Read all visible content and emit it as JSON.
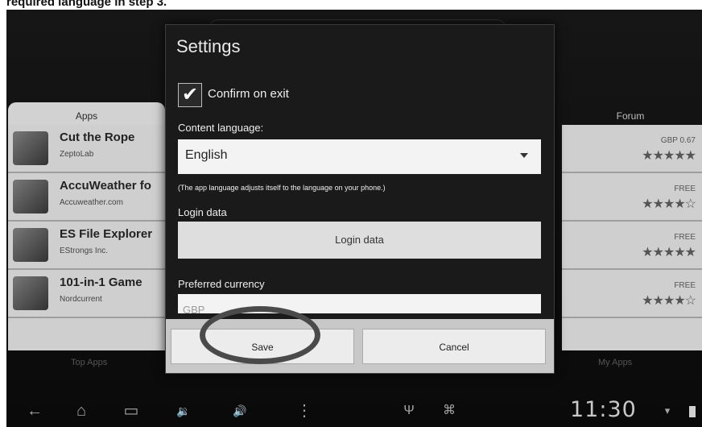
{
  "caption": "required language in step 3.",
  "background": {
    "tabs": {
      "apps": "Apps",
      "forum": "Forum"
    },
    "apps": [
      {
        "title": "Cut the Rope",
        "developer": "ZeptoLab",
        "price": "GBP 0.67",
        "stars": "★★★★★"
      },
      {
        "title": "AccuWeather fo",
        "developer": "Accuweather.com",
        "price": "FREE",
        "stars": "★★★★☆"
      },
      {
        "title": "ES File Explorer",
        "developer": "EStrongs Inc.",
        "price": "FREE",
        "stars": "★★★★★"
      },
      {
        "title": "101-in-1 Game",
        "developer": "Nordcurrent",
        "price": "FREE",
        "stars": "★★★★☆"
      }
    ],
    "bottom_tabs": {
      "left": "Top Apps",
      "right": "My Apps"
    }
  },
  "dialog": {
    "title": "Settings",
    "confirm_exit": {
      "label": "Confirm on exit",
      "checked": true,
      "check_glyph": "✔"
    },
    "content_language": {
      "label": "Content language:",
      "value": "English"
    },
    "language_note": "(The app language adjusts itself to the language on your phone.)",
    "login_data": {
      "label": "Login data",
      "button": "Login data"
    },
    "preferred_currency": {
      "label": "Preferred currency",
      "value": "GBP"
    },
    "buttons": {
      "save": "Save",
      "cancel": "Cancel"
    }
  },
  "status_bar": {
    "clock": "11:30",
    "icons": [
      "back-icon",
      "home-icon",
      "recent-apps-icon",
      "volume-down-icon",
      "volume-up-icon",
      "menu-icon",
      "usb-icon",
      "android-icon",
      "wifi-icon",
      "battery-icon"
    ]
  }
}
